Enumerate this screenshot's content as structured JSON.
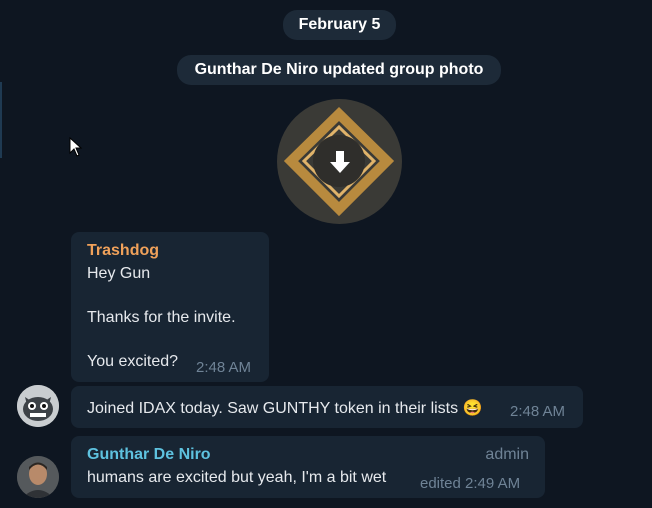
{
  "chat": {
    "date": "February 5",
    "service_message": "Gunthar De Niro updated group photo",
    "messages": [
      {
        "sender": "Trashdog",
        "lines": [
          "Hey Gun",
          "Thanks for the invite.",
          "You excited?"
        ],
        "time": "2:48 AM"
      },
      {
        "text": "Joined IDAX today. Saw GUNTHY token in their lists",
        "emoji": "😆",
        "time": "2:48 AM"
      },
      {
        "sender": "Gunthar De Niro",
        "role": "admin",
        "text": "humans are excited but yeah, I'm a bit wet",
        "time": "edited 2:49 AM"
      }
    ]
  },
  "colors": {
    "background": "#0e1621",
    "bubble": "#182533",
    "pill": "#1d2a38",
    "sender_orange": "#f0a15a",
    "sender_blue": "#5ec2df",
    "meta": "#6f8396"
  },
  "icons": {
    "group_photo": "gunthy-diamond-logo",
    "download": "download-arrow-icon",
    "cursor": "mouse-pointer-icon"
  }
}
